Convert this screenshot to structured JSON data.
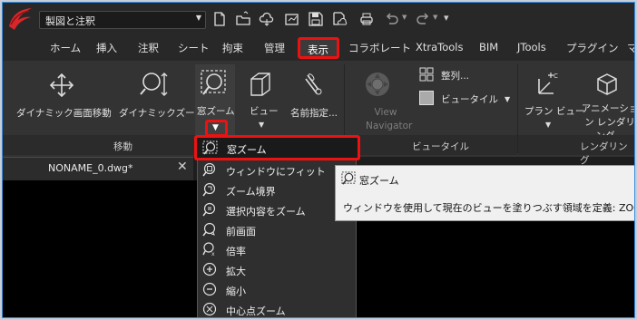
{
  "titlebar": {
    "drawing_combo": "製図と注釈"
  },
  "menubar": {
    "items": [
      "ホーム",
      "挿入",
      "注釈",
      "シート",
      "拘束",
      "管理",
      "表示",
      "コラボレート",
      "XtraTools",
      "BIM",
      "JTools",
      "プラグイン",
      "マ"
    ],
    "active": "表示"
  },
  "ribbon": {
    "pan_label": "ダイナミック画面移動",
    "dynzoom_label": "ダイナミックズーム",
    "window_zoom_label": "窓ズーム",
    "view_label": "ビュー",
    "named_view_label": "名前指定...",
    "view_navigator_label": "View Navigator",
    "arrange_label": "整列...",
    "viewport_label": "ビュータイル",
    "plan_view_label": "プラン ビュー",
    "animation_label": "アニメーション レンダリング...",
    "panel_move": "移動",
    "panel_viewtile": "ビュータイル",
    "panel_rendering": "レンダリング"
  },
  "document": {
    "tab_name": "NONAME_0.dwg*",
    "close_glyph": "✕"
  },
  "dropdown": {
    "items": [
      "窓ズーム",
      "ウィンドウにフィット",
      "ズーム境界",
      "選択内容をズーム",
      "前画面",
      "倍率",
      "拡大",
      "縮小",
      "中心点ズーム"
    ]
  },
  "tooltip": {
    "title": "窓ズーム",
    "description": "ウィンドウを使用して現在のビューを塗りつぶす領域を定義: ZOOM"
  },
  "colors": {
    "highlight": "#e11111",
    "ribbon_bg": "#333333",
    "canvas": "#000000"
  }
}
